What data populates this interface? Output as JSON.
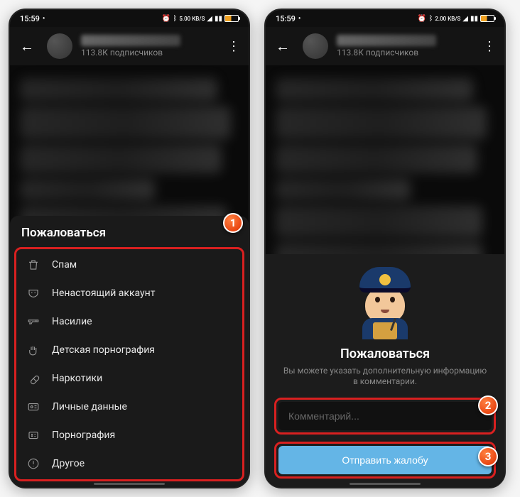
{
  "status": {
    "time": "15:59",
    "battery_pct": "47",
    "network": "5.00 KB/S",
    "network2": "2.00 KB/S"
  },
  "header": {
    "subscribers": "113.8К подписчиков"
  },
  "sheet": {
    "title": "Пожаловаться",
    "items": [
      {
        "label": "Спам"
      },
      {
        "label": "Ненастоящий аккаунт"
      },
      {
        "label": "Насилие"
      },
      {
        "label": "Детская порнография"
      },
      {
        "label": "Наркотики"
      },
      {
        "label": "Личные данные"
      },
      {
        "label": "Порнография"
      },
      {
        "label": "Другое"
      }
    ]
  },
  "panel2": {
    "title": "Пожаловаться",
    "subtitle": "Вы можете указать дополнительную информацию в комментарии.",
    "comment_placeholder": "Комментарий...",
    "submit_label": "Отправить жалобу"
  },
  "callouts": {
    "one": "1",
    "two": "2",
    "three": "3"
  }
}
